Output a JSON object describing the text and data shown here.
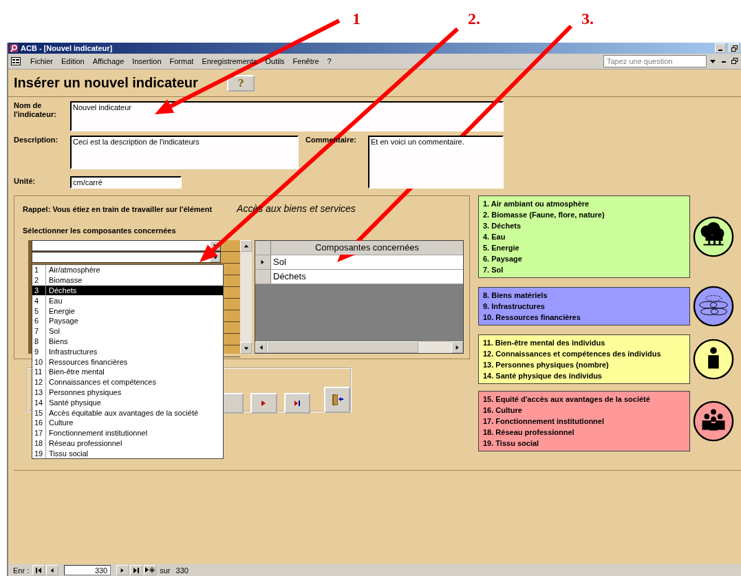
{
  "annotations": [
    {
      "label": "1"
    },
    {
      "label": "2."
    },
    {
      "label": "3."
    }
  ],
  "window": {
    "title": "ACB - [Nouvel indicateur]"
  },
  "menu": [
    {
      "label": "Fichier"
    },
    {
      "label": "Edition"
    },
    {
      "label": "Affichage"
    },
    {
      "label": "Insertion"
    },
    {
      "label": "Format"
    },
    {
      "label": "Enregistrements"
    },
    {
      "label": "Outils"
    },
    {
      "label": "Fenêtre"
    },
    {
      "label": "?"
    }
  ],
  "help_search": {
    "placeholder": "Tapez une question"
  },
  "form": {
    "title": "Insérer un nouvel indicateur",
    "help_button": "?"
  },
  "fields": {
    "name": {
      "label": "Nom de l'indicateur:",
      "value": "Nouvel indicateur"
    },
    "description": {
      "label": "Description:",
      "value": "Ceci est la description de l'indicateurs"
    },
    "comment": {
      "label": "Commentaire:",
      "value": "Et en voici un commentaire."
    },
    "unit": {
      "label": "Unité:",
      "value": "cm/carré"
    }
  },
  "reminder": {
    "text": "Rappel: Vous étiez en train de travailler sur l'élément",
    "element": "Accès aux biens et services"
  },
  "selection": {
    "label": "Sélectionner les composantes concernées",
    "dropdown": [
      {
        "number": "1",
        "label": "Air/atmosphère",
        "selected": false
      },
      {
        "number": "2",
        "label": "Biomasse",
        "selected": false
      },
      {
        "number": "3",
        "label": "Déchets",
        "selected": true
      },
      {
        "number": "4",
        "label": "Eau",
        "selected": false
      },
      {
        "number": "5",
        "label": "Energie",
        "selected": false
      },
      {
        "number": "6",
        "label": "Paysage",
        "selected": false
      },
      {
        "number": "7",
        "label": "Sol",
        "selected": false
      },
      {
        "number": "8",
        "label": "Biens",
        "selected": false
      },
      {
        "number": "9",
        "label": "Infrastructures",
        "selected": false
      },
      {
        "number": "10",
        "label": "Ressources financières",
        "selected": false
      },
      {
        "number": "11",
        "label": "Bien-être mental",
        "selected": false
      },
      {
        "number": "12",
        "label": "Connaissances et compétences",
        "selected": false
      },
      {
        "number": "13",
        "label": "Personnes physiques",
        "selected": false
      },
      {
        "number": "14",
        "label": "Santé physique",
        "selected": false
      },
      {
        "number": "15",
        "label": "Accès équitable aux avantages de la société",
        "selected": false
      },
      {
        "number": "16",
        "label": "Culture",
        "selected": false
      },
      {
        "number": "17",
        "label": "Fonctionnement institutionnel",
        "selected": false
      },
      {
        "number": "18",
        "label": "Réseau professionnel",
        "selected": false
      },
      {
        "number": "19",
        "label": "Tissu social",
        "selected": false
      }
    ]
  },
  "datasheet": {
    "column": "Composantes concernées",
    "rows": [
      {
        "value": "Sol",
        "current": true
      },
      {
        "value": "Déchets",
        "current": false
      }
    ]
  },
  "categories": [
    {
      "kind": "nature",
      "color": "#ccff99",
      "items": [
        "1. Air ambiant ou atmosphère",
        "2. Biomasse (Faune, flore, nature)",
        "3. Déchets",
        "4. Eau",
        "5. Energie",
        "6. Paysage",
        "7. Sol"
      ]
    },
    {
      "kind": "assets",
      "color": "#9999ff",
      "items": [
        "8. Biens matériels",
        "9. Infrastructures",
        "10. Ressources financières"
      ]
    },
    {
      "kind": "person",
      "color": "#ffff99",
      "items": [
        "11. Bien-être mental des individus",
        "12. Connaissances et compétences des individus",
        "13. Personnes physiques (nombre)",
        "14. Santé physique des individus"
      ]
    },
    {
      "kind": "group",
      "color": "#ff9999",
      "items": [
        "15. Equité d'accès aux avantages de la société",
        "16. Culture",
        "17. Fonctionnement institutionnel",
        "18. Réseau professionnel",
        "19. Tissu social"
      ]
    }
  ],
  "record_nav": {
    "label": "Enr :",
    "current": "330",
    "of": "sur",
    "total": "330"
  }
}
